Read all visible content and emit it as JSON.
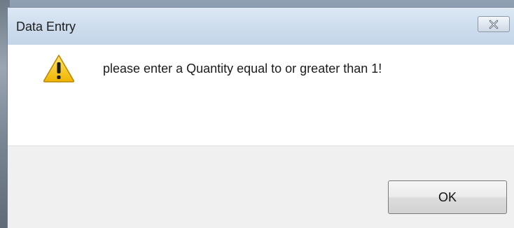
{
  "window": {
    "title": "Data Entry",
    "close_icon": "close-icon"
  },
  "message": {
    "icon": "warning-icon",
    "text": "please enter a Quantity equal to or greater than 1!"
  },
  "buttons": {
    "ok_label": "OK"
  },
  "colors": {
    "titlebar": "#c3d5e9",
    "content_bg": "#ffffff",
    "footer_bg": "#f0f0f0",
    "warning_yellow": "#f5c400"
  }
}
